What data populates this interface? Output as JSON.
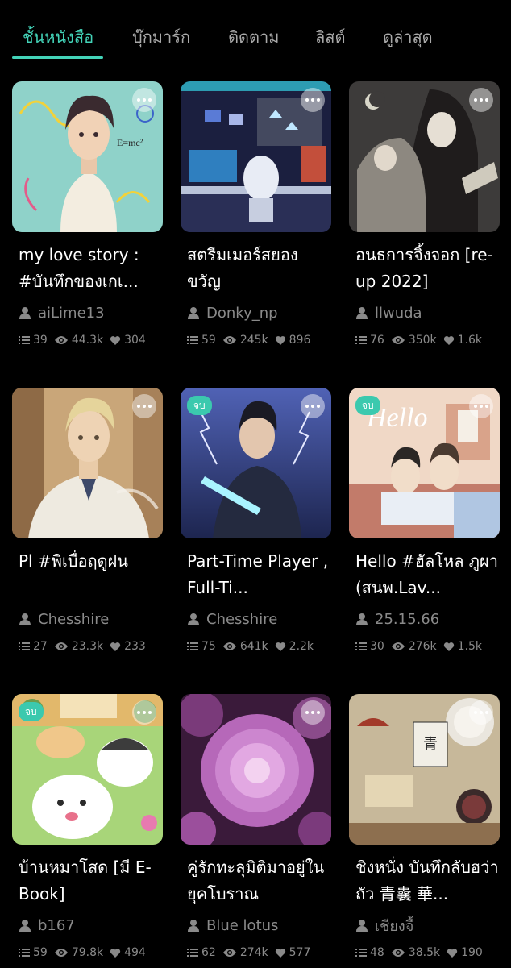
{
  "tabs": [
    {
      "label": "ชั้นหนังสือ",
      "active": true
    },
    {
      "label": "บุ๊กมาร์ก",
      "active": false
    },
    {
      "label": "ติดตาม",
      "active": false
    },
    {
      "label": "ลิสต์",
      "active": false
    },
    {
      "label": "ดูล่าสุด",
      "active": false
    }
  ],
  "books": [
    {
      "title": "my love story : #บันทึกของเกเ...",
      "author": "aiLime13",
      "chapters": "39",
      "views": "44.3k",
      "likes": "304",
      "completed": false,
      "end_label": ""
    },
    {
      "title": "สตรีมเมอร์สยองขวัญ",
      "author": "Donky_np",
      "chapters": "59",
      "views": "245k",
      "likes": "896",
      "completed": false,
      "end_label": ""
    },
    {
      "title": "อนธการจิ้งจอก [re-up 2022]",
      "author": "llwuda",
      "chapters": "76",
      "views": "350k",
      "likes": "1.6k",
      "completed": false,
      "end_label": ""
    },
    {
      "title": "Pl #พิเบื่อฤดูฝน",
      "author": "Chesshire",
      "chapters": "27",
      "views": "23.3k",
      "likes": "233",
      "completed": false,
      "end_label": ""
    },
    {
      "title": "Part-Time Player , Full-Ti...",
      "author": "Chesshire",
      "chapters": "75",
      "views": "641k",
      "likes": "2.2k",
      "completed": true,
      "end_label": "จบ"
    },
    {
      "title": "Hello #ฮัลโหล ภูผา (สนพ.Lav...",
      "author": "25.15.66",
      "chapters": "30",
      "views": "276k",
      "likes": "1.5k",
      "completed": true,
      "end_label": "จบ"
    },
    {
      "title": "บ้านหมาโสด [มี E-Book]",
      "author": "b167",
      "chapters": "59",
      "views": "79.8k",
      "likes": "494",
      "completed": true,
      "end_label": "จบ"
    },
    {
      "title": "คู่รักทะลุมิติมาอยู่ในยุคโบราณ",
      "author": "Blue lotus",
      "chapters": "62",
      "views": "274k",
      "likes": "577",
      "completed": false,
      "end_label": ""
    },
    {
      "title": "ชิงหนั่ง บันทึกลับฮว่าถัว 青囊 華...",
      "author": "เชียงจื้",
      "chapters": "48",
      "views": "38.5k",
      "likes": "190",
      "completed": false,
      "end_label": ""
    }
  ],
  "icons": {
    "chapters": "list-icon",
    "views": "eye-icon",
    "likes": "heart-icon",
    "author": "person-icon",
    "more": "more-dots-icon"
  },
  "colors": {
    "accent": "#43d3b8",
    "badge": "#3bc9ae",
    "muted": "#8a8a8a",
    "background": "#000000"
  }
}
